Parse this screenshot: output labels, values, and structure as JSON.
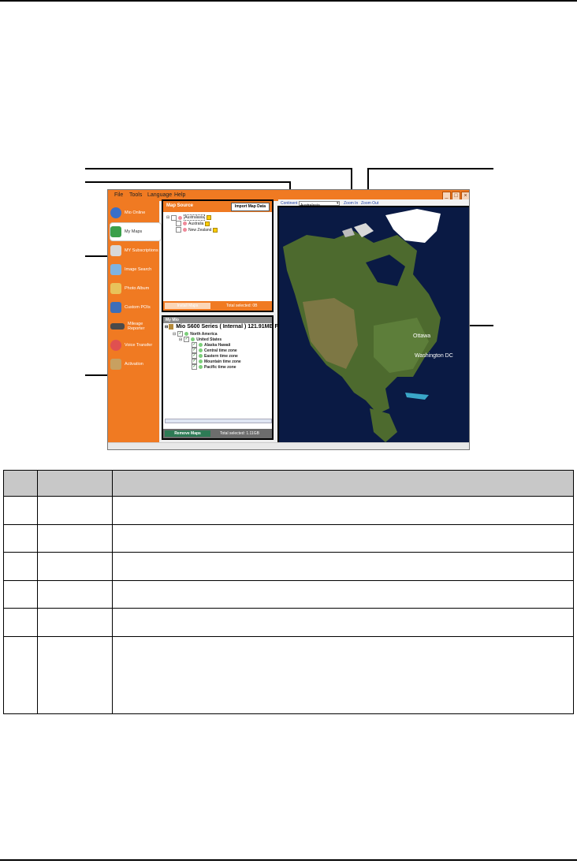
{
  "app": {
    "menu": [
      "File",
      "Tools",
      "Language",
      "Help"
    ],
    "window_buttons": [
      "_",
      "□",
      "×"
    ],
    "sidebar": {
      "items": [
        {
          "label": "Mio Online",
          "icon": "globe-icon",
          "color": "#3a6fc9"
        },
        {
          "label": "My Maps",
          "icon": "map-icon",
          "color": "#3aa04a"
        },
        {
          "label": "MY Subscriptions",
          "icon": "envelope-icon",
          "color": "#d8d8d8"
        },
        {
          "label": "Image Search",
          "icon": "image-search-icon",
          "color": "#7fb3e0"
        },
        {
          "label": "Photo Album",
          "icon": "photo-album-icon",
          "color": "#e8c35a"
        },
        {
          "label": "Custom POIs",
          "icon": "poi-icon",
          "color": "#3d6eb8"
        },
        {
          "label": "Mileage Reporter",
          "icon": "mileage-icon",
          "color": "#4a4a4a"
        },
        {
          "label": "Voice Transfer",
          "icon": "voice-icon",
          "color": "#e05050"
        },
        {
          "label": "Activation",
          "icon": "activation-icon",
          "color": "#c8a060"
        }
      ],
      "active_index": 1
    },
    "map_source": {
      "title": "Map Source",
      "import_button": "Import Map Data",
      "tree": [
        {
          "label": "Australasia"
        },
        {
          "label": "Australia"
        },
        {
          "label": "New Zealand"
        }
      ],
      "install_button": "Install Maps",
      "total_selected": "Total selected: 0B"
    },
    "my_mio": {
      "title": "My Mio",
      "device": "Mio S600 Series ( Internal ) 121.91MB F",
      "tree": [
        {
          "label": "North America"
        },
        {
          "label": "United States"
        },
        {
          "label": "Alaska Hawaii"
        },
        {
          "label": "Central time zone"
        },
        {
          "label": "Eastern time zone"
        },
        {
          "label": "Mountain time zone"
        },
        {
          "label": "Pacific time zone"
        }
      ],
      "remove_button": "Remove Maps",
      "total_selected": "Total selected: 1.11GB"
    },
    "map_toolbar": {
      "continent_label": "Continent",
      "continent_value": "Australasia",
      "zoom_in": "Zoom In",
      "zoom_out": "Zoom Out"
    },
    "map_labels": {
      "city1": "Ottawa",
      "city2": "Washington DC"
    }
  },
  "colors": {
    "accent": "#f07a22",
    "ocean": "#0a1a44",
    "land": "#4d6a2e",
    "ice": "#ffffff"
  }
}
